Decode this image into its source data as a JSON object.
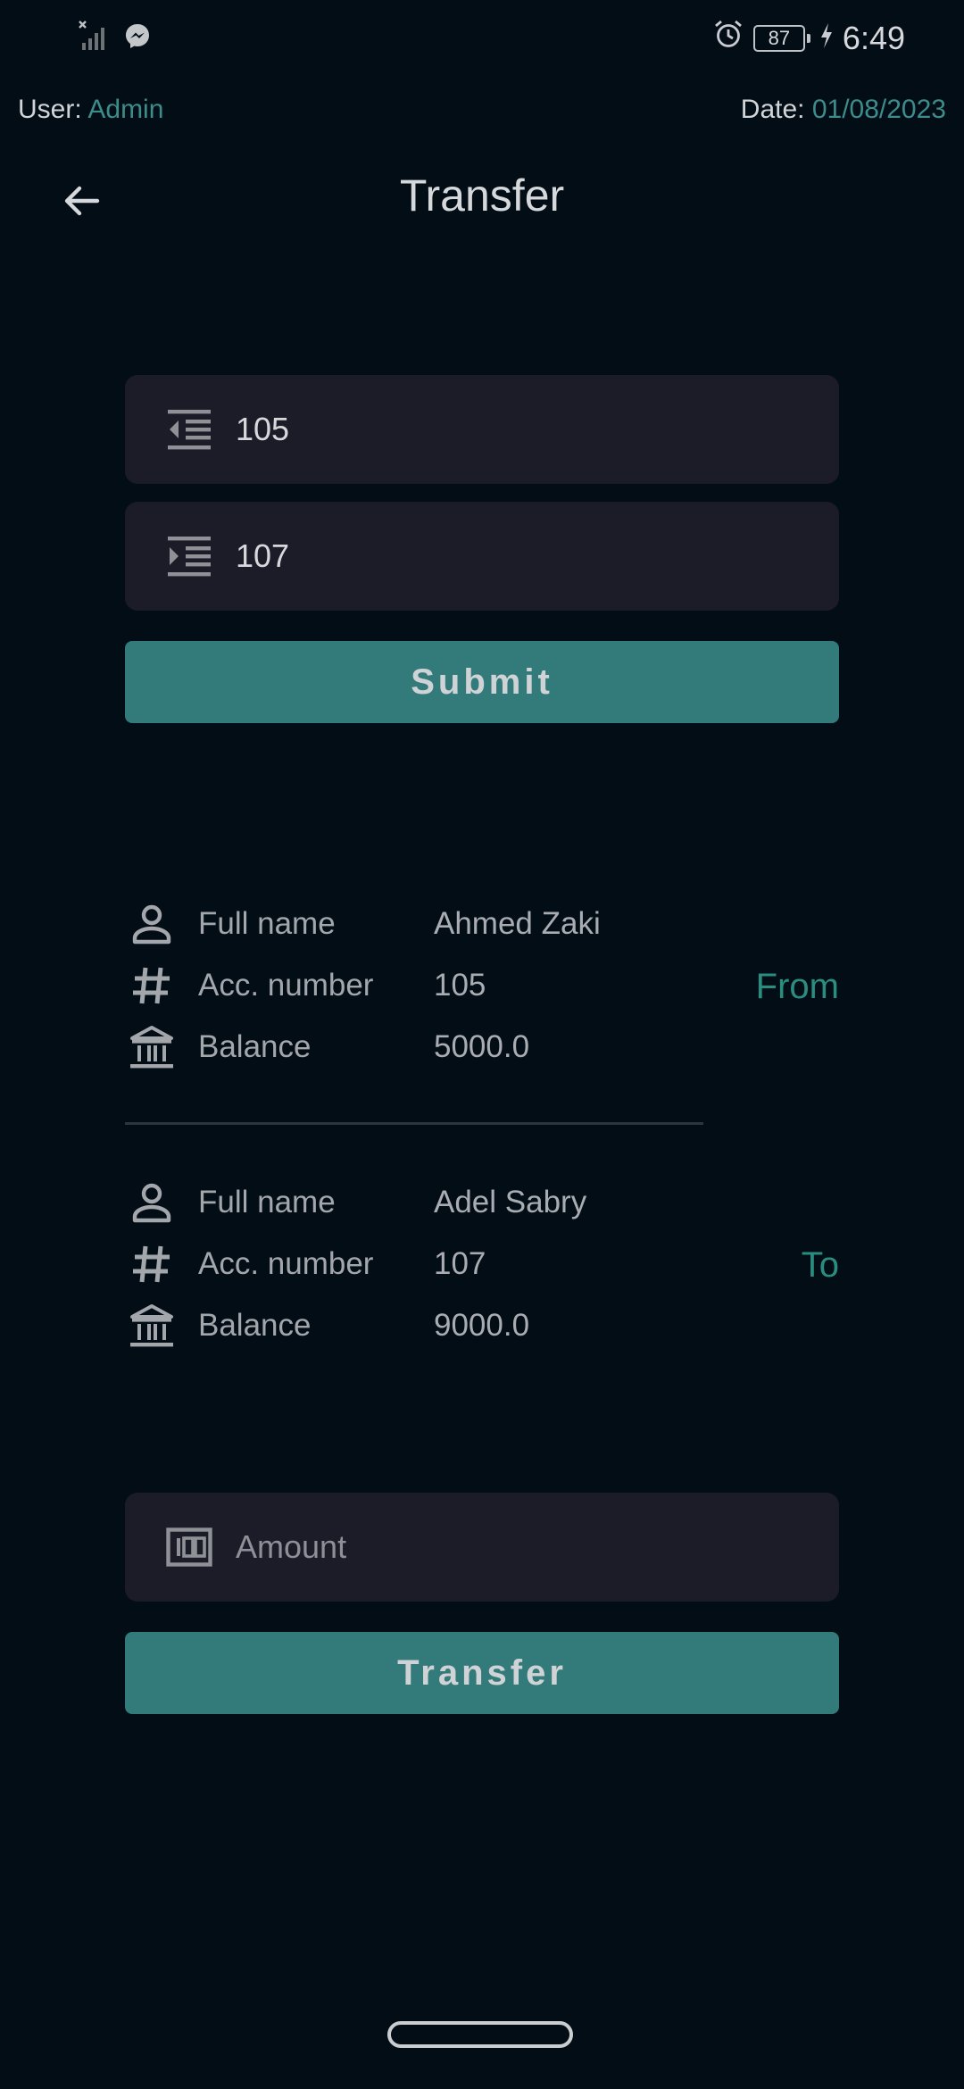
{
  "status_bar": {
    "time": "6:49",
    "battery_level": "87",
    "icons": [
      "no-signal-icon",
      "messenger-icon",
      "alarm-icon",
      "battery-icon",
      "charging-icon"
    ]
  },
  "meta": {
    "user_label": "User:",
    "user_value": "Admin",
    "date_label": "Date:",
    "date_value": "01/08/2023"
  },
  "app_bar": {
    "title": "Transfer"
  },
  "from_field": {
    "value": "105",
    "icon": "indent-decrease-icon"
  },
  "to_field": {
    "value": "107",
    "icon": "indent-increase-icon"
  },
  "submit_label": "Submit",
  "from_account": {
    "tag": "From",
    "rows": [
      {
        "label": "Full name",
        "value": "Ahmed Zaki",
        "icon": "person-icon"
      },
      {
        "label": "Acc. number",
        "value": "105",
        "icon": "hash-icon"
      },
      {
        "label": "Balance",
        "value": "5000.0",
        "icon": "bank-icon"
      }
    ]
  },
  "to_account": {
    "tag": "To",
    "rows": [
      {
        "label": "Full name",
        "value": "Adel Sabry",
        "icon": "person-icon"
      },
      {
        "label": "Acc. number",
        "value": "107",
        "icon": "hash-icon"
      },
      {
        "label": "Balance",
        "value": "9000.0",
        "icon": "bank-icon"
      }
    ]
  },
  "amount_field": {
    "placeholder": "Amount",
    "value": "",
    "icon": "money-icon"
  },
  "transfer_label": "Transfer",
  "colors": {
    "background": "#020d16",
    "accent": "#3d8c8b",
    "button": "#337a7a",
    "field": "#1c1c28",
    "tag": "#2b8c80"
  }
}
